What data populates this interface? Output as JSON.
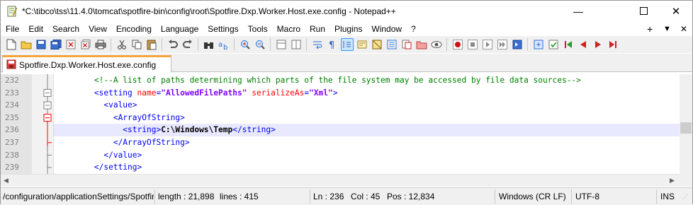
{
  "window": {
    "title": "*C:\\tibco\\tss\\11.4.0\\tomcat\\spotfire-bin\\config\\root\\Spotfire.Dxp.Worker.Host.exe.config - Notepad++",
    "minimize_glyph": "—",
    "maximize_glyph": "☐",
    "close_glyph": "✕"
  },
  "menu": {
    "items": [
      "File",
      "Edit",
      "Search",
      "View",
      "Encoding",
      "Language",
      "Settings",
      "Tools",
      "Macro",
      "Run",
      "Plugins",
      "Window",
      "?"
    ],
    "plus_glyph": "+",
    "dropdown_glyph": "▼",
    "close_doc_glyph": "✕"
  },
  "tab": {
    "label": "Spotfire.Dxp.Worker.Host.exe.config"
  },
  "editor": {
    "lines": [
      {
        "num": "232",
        "indent": "        ",
        "segments": [
          {
            "cls": "cmt",
            "text": "<!--A list of paths determining which parts of the file system may be accessed by file data sources-->"
          }
        ]
      },
      {
        "num": "233",
        "indent": "        ",
        "segments": [
          {
            "cls": "tag",
            "text": "<setting "
          },
          {
            "cls": "attr",
            "text": "name"
          },
          {
            "cls": "tag",
            "text": "="
          },
          {
            "cls": "val",
            "text": "\"AllowedFilePaths\""
          },
          {
            "cls": "tag",
            "text": " "
          },
          {
            "cls": "attr",
            "text": "serializeAs"
          },
          {
            "cls": "tag",
            "text": "="
          },
          {
            "cls": "val",
            "text": "\"Xml\""
          },
          {
            "cls": "tag",
            "text": ">"
          }
        ]
      },
      {
        "num": "234",
        "indent": "          ",
        "segments": [
          {
            "cls": "tag",
            "text": "<value>"
          }
        ]
      },
      {
        "num": "235",
        "indent": "            ",
        "segments": [
          {
            "cls": "tag",
            "text": "<ArrayOfString>"
          }
        ]
      },
      {
        "num": "236",
        "indent": "              ",
        "segments": [
          {
            "cls": "tag",
            "text": "<string>"
          },
          {
            "cls": "txt",
            "text": "C:\\Windows\\Temp"
          },
          {
            "cls": "tag",
            "text": "</string>"
          }
        ]
      },
      {
        "num": "237",
        "indent": "            ",
        "segments": [
          {
            "cls": "tag",
            "text": "</ArrayOfString>"
          }
        ]
      },
      {
        "num": "238",
        "indent": "          ",
        "segments": [
          {
            "cls": "tag",
            "text": "</value>"
          }
        ]
      },
      {
        "num": "239",
        "indent": "        ",
        "segments": [
          {
            "cls": "tag",
            "text": "</setting>"
          }
        ]
      }
    ],
    "current_line": "236"
  },
  "status": {
    "path": "/configuration/applicationSettings/Spotfire.Dxp",
    "length": "length : 21,898",
    "lines": "lines : 415",
    "ln": "Ln : 236",
    "col": "Col : 45",
    "pos": "Pos : 12,834",
    "eol": "Windows (CR LF)",
    "encoding": "UTF-8",
    "mode": "INS"
  },
  "colors": {
    "tag": "#0000ff",
    "attribute": "#ff0000",
    "attribute_value": "#8000ff",
    "comment": "#008000",
    "current_line_bg": "#e8e8ff",
    "tab_accent": "#f7a33e"
  }
}
